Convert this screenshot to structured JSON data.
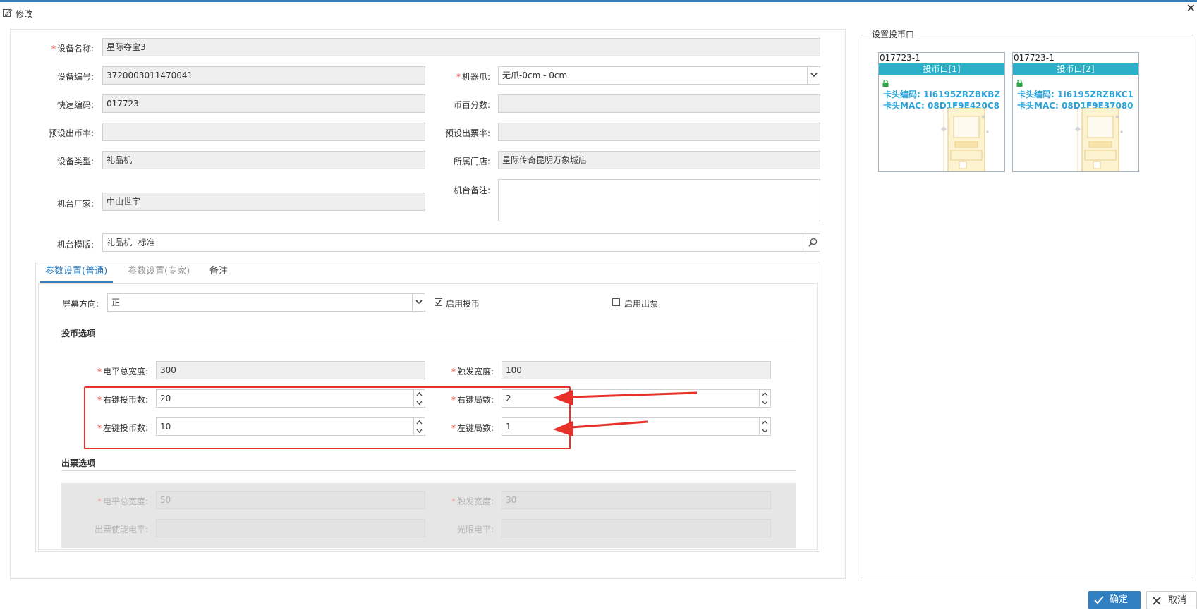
{
  "window": {
    "title": "修改"
  },
  "form": {
    "device_name": {
      "label": "设备名称:",
      "value": "星际夺宝3"
    },
    "device_no": {
      "label": "设备编号:",
      "value": "3720003011470041"
    },
    "claw": {
      "label": "机器爪:",
      "value": "无爪-0cm - 0cm"
    },
    "quick_code": {
      "label": "快速编码:",
      "value": "017723"
    },
    "coin_percent": {
      "label": "币百分数:",
      "value": ""
    },
    "preset_coin_rate": {
      "label": "预设出币率:",
      "value": ""
    },
    "preset_ticket_rate": {
      "label": "预设出票率:",
      "value": ""
    },
    "device_type": {
      "label": "设备类型:",
      "value": "礼品机"
    },
    "store": {
      "label": "所属门店:",
      "value": "星际传奇昆明万象城店"
    },
    "manufacturer": {
      "label": "机台厂家:",
      "value": "中山世宇"
    },
    "remark": {
      "label": "机台备注:",
      "value": ""
    },
    "template": {
      "label": "机台模版:",
      "value": "礼品机--标准"
    }
  },
  "tabs": [
    {
      "label": "参数设置(普通)",
      "state": "active"
    },
    {
      "label": "参数设置(专家)",
      "state": "disabled"
    },
    {
      "label": "备注",
      "state": "normal"
    }
  ],
  "params": {
    "screen_direction": {
      "label": "屏幕方向:",
      "value": "正"
    },
    "enable_coin": {
      "label": "启用投币",
      "checked": true
    },
    "enable_ticket": {
      "label": "启用出票",
      "checked": false
    },
    "coin_section_title": "投币选项",
    "level_total_width": {
      "label": "电平总宽度:",
      "value": "300"
    },
    "trigger_width": {
      "label": "触发宽度:",
      "value": "100"
    },
    "right_coin_count": {
      "label": "右键投币数:",
      "value": "20"
    },
    "right_rounds": {
      "label": "右键局数:",
      "value": "2"
    },
    "left_coin_count": {
      "label": "左键投币数:",
      "value": "10"
    },
    "left_rounds": {
      "label": "左键局数:",
      "value": "1"
    },
    "ticket_section_title": "出票选项",
    "ticket_level_total_width": {
      "label": "电平总宽度:",
      "value": "50"
    },
    "ticket_trigger_width": {
      "label": "触发宽度:",
      "value": "30"
    },
    "ticket_enable_level": {
      "label": "出票使能电平:",
      "value": ""
    },
    "photo_level": {
      "label": "光眼电平:",
      "value": ""
    }
  },
  "coin_ports": {
    "legend": "设置投币口",
    "cards": [
      {
        "code": "017723-1",
        "title": "投币口[1]",
        "card_code_line": "卡头编码: 1I6195ZRZBKBZ",
        "mac_line": "卡头MAC: 08D1F9E420C8"
      },
      {
        "code": "017723-1",
        "title": "投币口[2]",
        "card_code_line": "卡头编码: 1I6195ZRZBKC1",
        "mac_line": "卡头MAC: 08D1F9E37080"
      }
    ]
  },
  "buttons": {
    "ok": "确定",
    "cancel": "取消"
  },
  "colors": {
    "accent": "#2f7fc1",
    "required": "#e53935",
    "annotation": "#e8312b",
    "card_header": "#2bb0c8",
    "card_text": "#2aa3d8"
  },
  "icons": [
    "edit-icon",
    "close-icon",
    "chevron-down-icon",
    "search-icon",
    "spinner-arrows-icon",
    "checkbox-icon",
    "lock-icon",
    "arcade-machine-icon",
    "check-icon",
    "close-icon"
  ]
}
